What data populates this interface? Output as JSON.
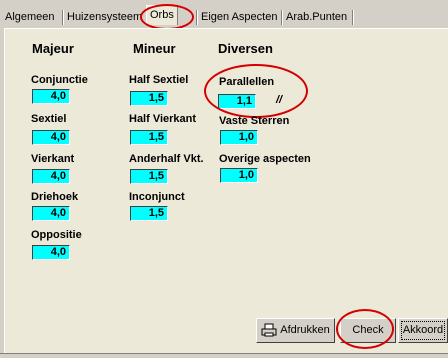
{
  "tabs": [
    "Algemeen",
    "Huizensysteem",
    "Orbs",
    "Eigen Aspecten",
    "Arab.Punten"
  ],
  "active_tab": "Orbs",
  "columns": {
    "majeur": {
      "title": "Majeur",
      "items": [
        {
          "label": "Conjunctie",
          "value": "4,0"
        },
        {
          "label": "Sextiel",
          "value": "4,0"
        },
        {
          "label": "Vierkant",
          "value": "4,0"
        },
        {
          "label": "Driehoek",
          "value": "4,0"
        },
        {
          "label": "Oppositie",
          "value": "4,0"
        }
      ]
    },
    "mineur": {
      "title": "Mineur",
      "items": [
        {
          "label": "Half Sextiel",
          "value": "1,5"
        },
        {
          "label": "Half Vierkant",
          "value": "1,5"
        },
        {
          "label": "Anderhalf Vkt.",
          "value": "1,5"
        },
        {
          "label": "Inconjunct",
          "value": "1,5"
        }
      ]
    },
    "diversen": {
      "title": "Diversen",
      "items": [
        {
          "label": "Parallellen",
          "value": "1,1",
          "mark": "//"
        },
        {
          "label": "Vaste Sterren",
          "value": "1,0"
        },
        {
          "label": "Overige aspecten",
          "value": "1,0"
        }
      ]
    }
  },
  "buttons": {
    "print": "Afdrukken",
    "check": "Check",
    "ok": "Akkoord"
  }
}
